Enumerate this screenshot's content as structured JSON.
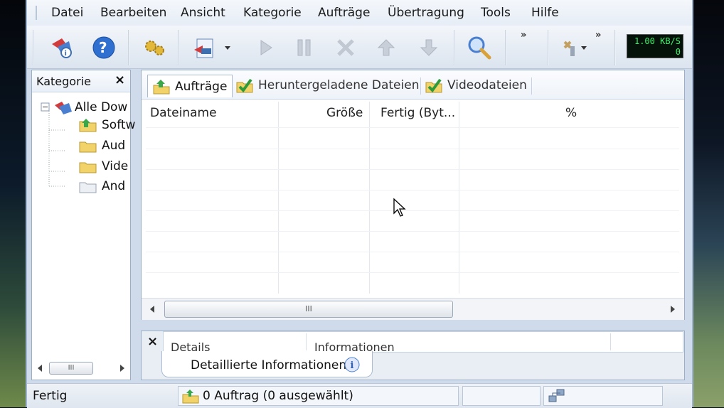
{
  "menu": {
    "items": [
      "Datei",
      "Bearbeiten",
      "Ansicht",
      "Kategorie",
      "Aufträge",
      "Übertragung",
      "Tools",
      "Hilfe"
    ]
  },
  "toolbar": {
    "more_glyph": "»",
    "speed_readout": [
      "1.00 KB/S",
      "0"
    ]
  },
  "categories": {
    "title": "Kategorie",
    "close": "×",
    "items": [
      {
        "label": "Alle Dow",
        "icon": "all-downloads-icon"
      },
      {
        "label": "Softw",
        "icon": "folder-software-icon"
      },
      {
        "label": "Aud",
        "icon": "folder-audio-icon"
      },
      {
        "label": "Vide",
        "icon": "folder-video-icon"
      },
      {
        "label": "And",
        "icon": "folder-other-icon"
      }
    ],
    "scroll_grip": "III"
  },
  "tabs": [
    {
      "label": "Aufträge",
      "icon": "jobs-icon"
    },
    {
      "label": "Heruntergeladene Dateien",
      "icon": "checkmark-icon"
    },
    {
      "label": "Videodateien",
      "icon": "checkmark-icon"
    }
  ],
  "columns": [
    "Dateiname",
    "Größe",
    "Fertig (Byt...",
    "%"
  ],
  "list_scroll_grip": "III",
  "details": {
    "close": "×",
    "columns": [
      "Details",
      "Informationen"
    ],
    "tab_label": "Detaillierte Informationen"
  },
  "status": {
    "state": "Fertig",
    "jobs": "0 Auftrag (0 ausgewählt)"
  },
  "colors": {
    "accent": "#3d6fb0",
    "speed_text": "#3ef06a"
  }
}
